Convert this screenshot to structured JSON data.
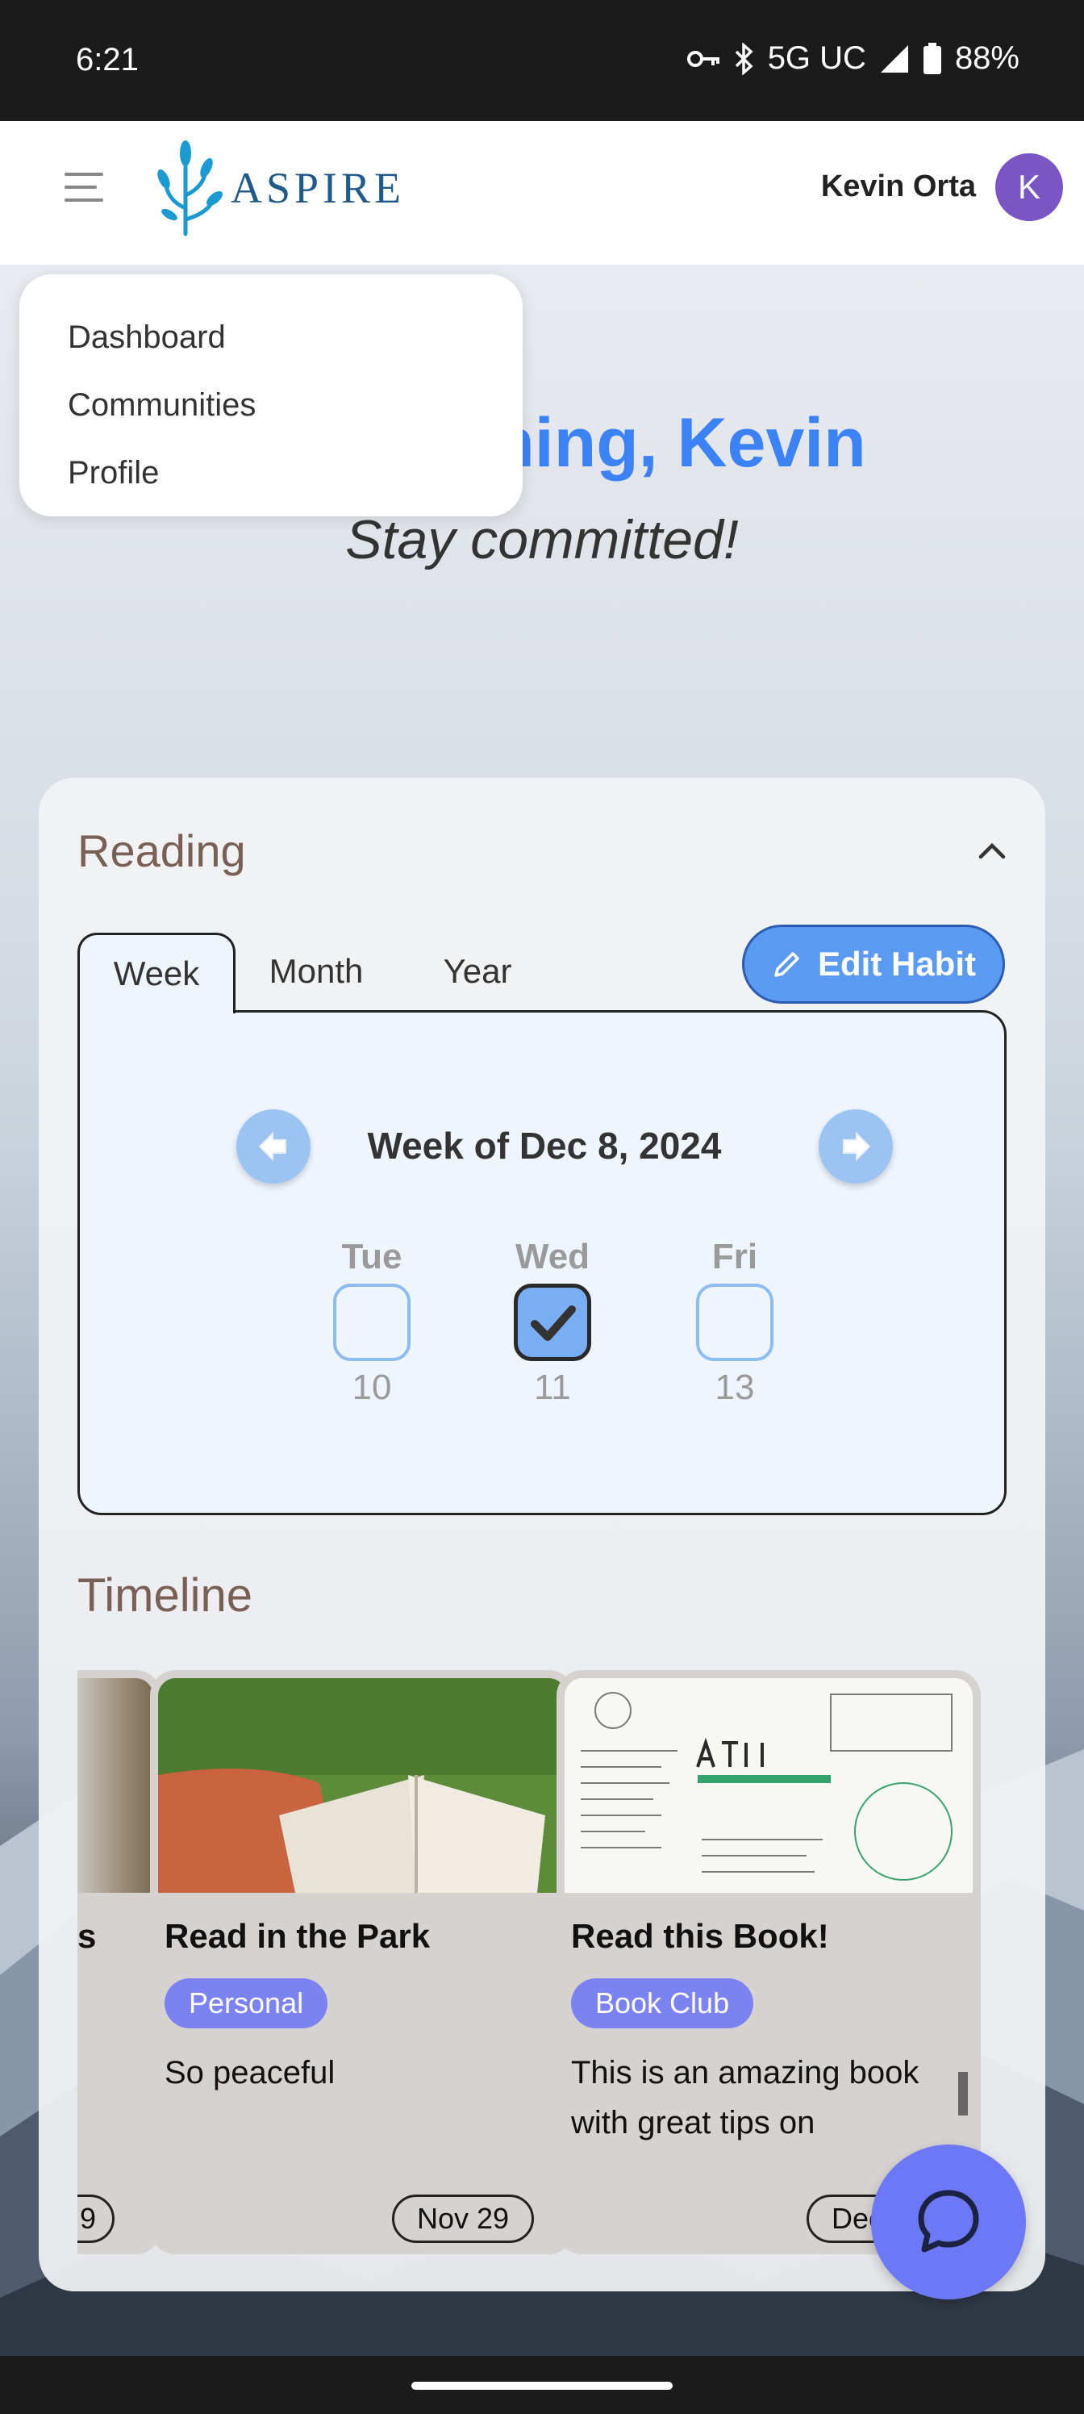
{
  "status_bar": {
    "time": "6:21",
    "network": "5G UC",
    "battery": "88%"
  },
  "app": {
    "brand": "ASPIRE",
    "user_name": "Kevin Orta",
    "avatar_initial": "K"
  },
  "menu": {
    "items": [
      {
        "label": "Dashboard"
      },
      {
        "label": "Communities"
      },
      {
        "label": "Profile"
      }
    ]
  },
  "hero": {
    "greeting_visible": "ning, Kevin",
    "tagline": "Stay committed!"
  },
  "habit": {
    "title": "Reading",
    "tabs": [
      "Week",
      "Month",
      "Year"
    ],
    "active_tab": "Week",
    "edit_label": "Edit Habit",
    "week_label": "Week of Dec 8, 2024",
    "days": [
      {
        "name": "Tue",
        "date": "10",
        "checked": false
      },
      {
        "name": "Wed",
        "date": "11",
        "checked": true
      },
      {
        "name": "Fri",
        "date": "13",
        "checked": false
      }
    ]
  },
  "timeline": {
    "title": "Timeline",
    "partial_card": {
      "title_tail": "s",
      "date_tail": "9"
    },
    "cards": [
      {
        "title": "Read in the Park",
        "tag": "Personal",
        "description": "So peaceful",
        "date": "Nov 29"
      },
      {
        "title": "Read this Book!",
        "tag": "Book Club",
        "description": "This is an amazing book with great tips on",
        "date": "Dec"
      }
    ]
  },
  "colors": {
    "accent": "#3b82f6",
    "tag": "#7b83f3",
    "avatar": "#7a55c4",
    "fab": "#6c78f5"
  },
  "icons": [
    "menu-icon",
    "vpn-key-icon",
    "bluetooth-icon",
    "signal-icon",
    "battery-icon",
    "chevron-up-icon",
    "pencil-icon",
    "arrow-left-icon",
    "arrow-right-icon",
    "checkmark-icon",
    "chat-bubble-icon"
  ]
}
